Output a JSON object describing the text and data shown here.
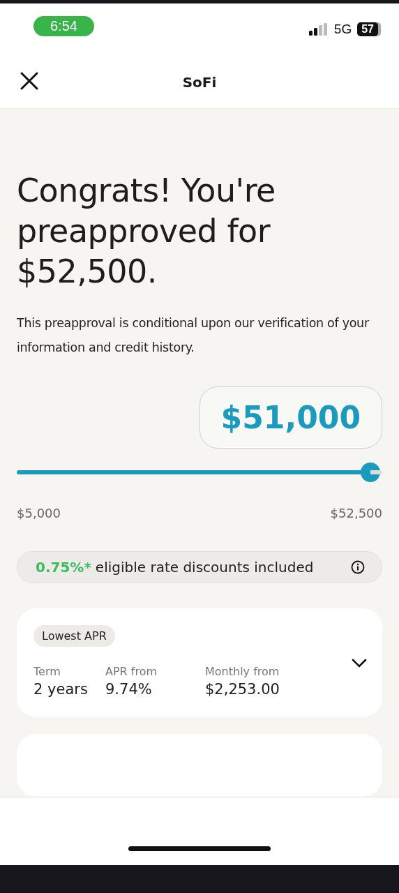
{
  "status_bar": {
    "time": "6:54",
    "network": "5G",
    "battery": "57"
  },
  "header": {
    "title": "SoFi"
  },
  "headline": "Congrats! You're preapproved for $52,500.",
  "disclaimer": "This preapproval is conditional upon our verification of your information and credit history.",
  "amount": {
    "value": "$51,000",
    "level": 0.968,
    "min_label": "$5,000",
    "max_label": "$52,500"
  },
  "discount": {
    "rate": "0.75%*",
    "text": "eligible rate discounts included"
  },
  "offers": [
    {
      "tag": "Lowest APR",
      "expanded": false,
      "columns": [
        {
          "label": "Term",
          "value": "2 years"
        },
        {
          "label": "APR from",
          "value": "9.74%"
        },
        {
          "label": "Monthly from",
          "value": "$2,253.00"
        }
      ]
    }
  ]
}
